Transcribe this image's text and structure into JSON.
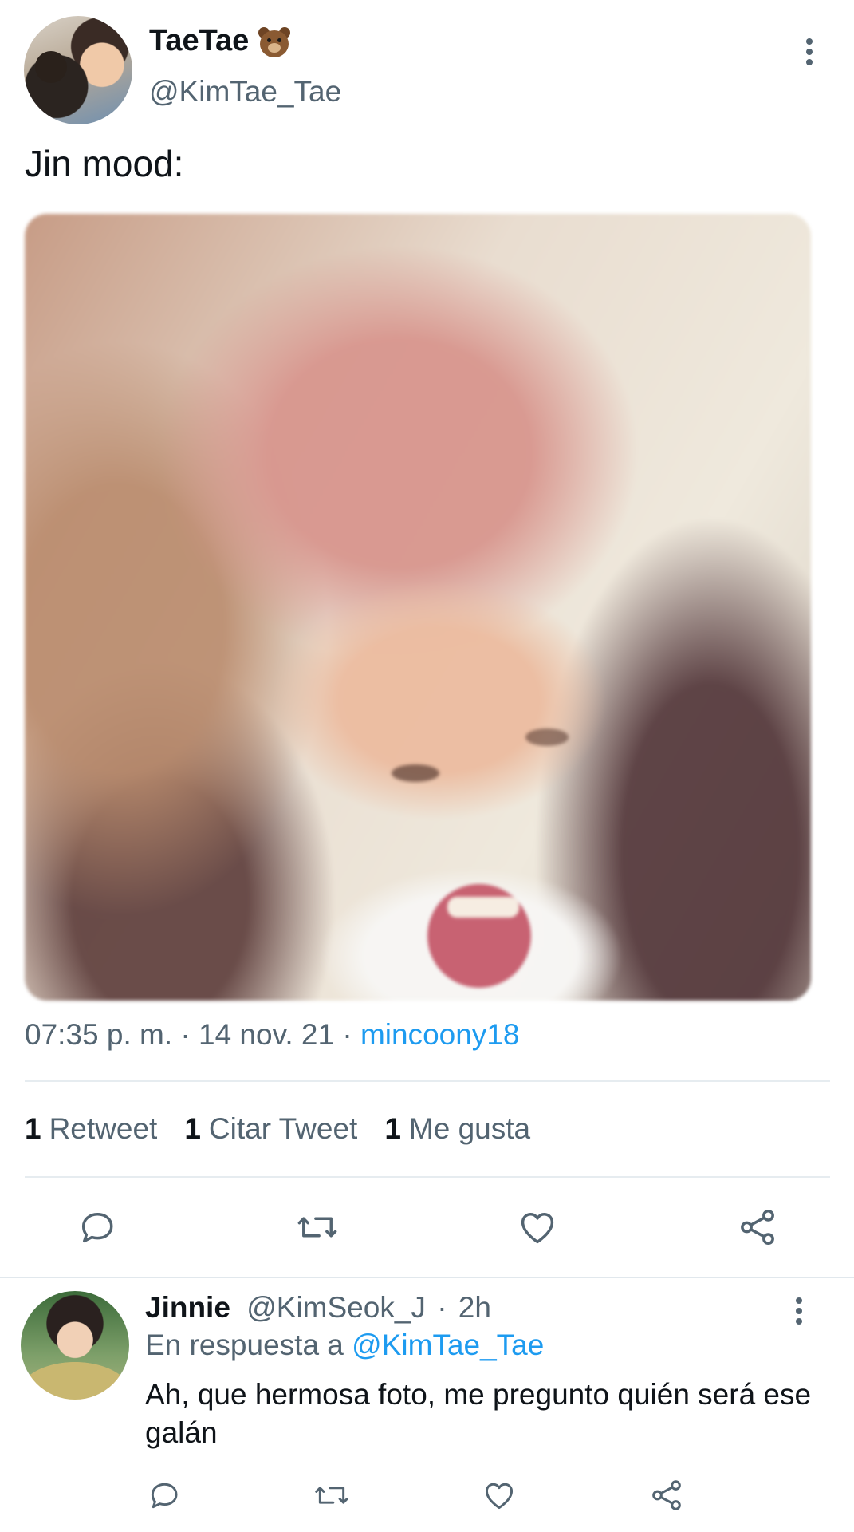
{
  "tweet": {
    "display_name": "TaeTae",
    "name_emoji": "bear-face-icon",
    "handle": "@KimTae_Tae",
    "text": "Jin mood:",
    "time": "07:35 p. m.",
    "date": "14 nov. 21",
    "source": "mincoony18",
    "sep": "·",
    "stats": {
      "retweets_count": "1",
      "retweets_label": "Retweet",
      "quotes_count": "1",
      "quotes_label": "Citar Tweet",
      "likes_count": "1",
      "likes_label": "Me gusta"
    },
    "actions": [
      "reply-icon",
      "retweet-icon",
      "like-icon",
      "share-icon"
    ]
  },
  "reply": {
    "display_name": "Jinnie",
    "handle": "@KimSeok_J",
    "sep": "·",
    "age": "2h",
    "reply_prefix": "En respuesta a",
    "reply_to": "@KimTae_Tae",
    "text": "Ah, que hermosa foto, me pregunto quién será ese galán",
    "actions": [
      "reply-icon",
      "retweet-icon",
      "like-icon",
      "share-icon"
    ]
  },
  "colors": {
    "accent": "#1d9bf0",
    "secondary_text": "#536471",
    "primary_text": "#0f1419",
    "divider": "#e6ecf0"
  }
}
